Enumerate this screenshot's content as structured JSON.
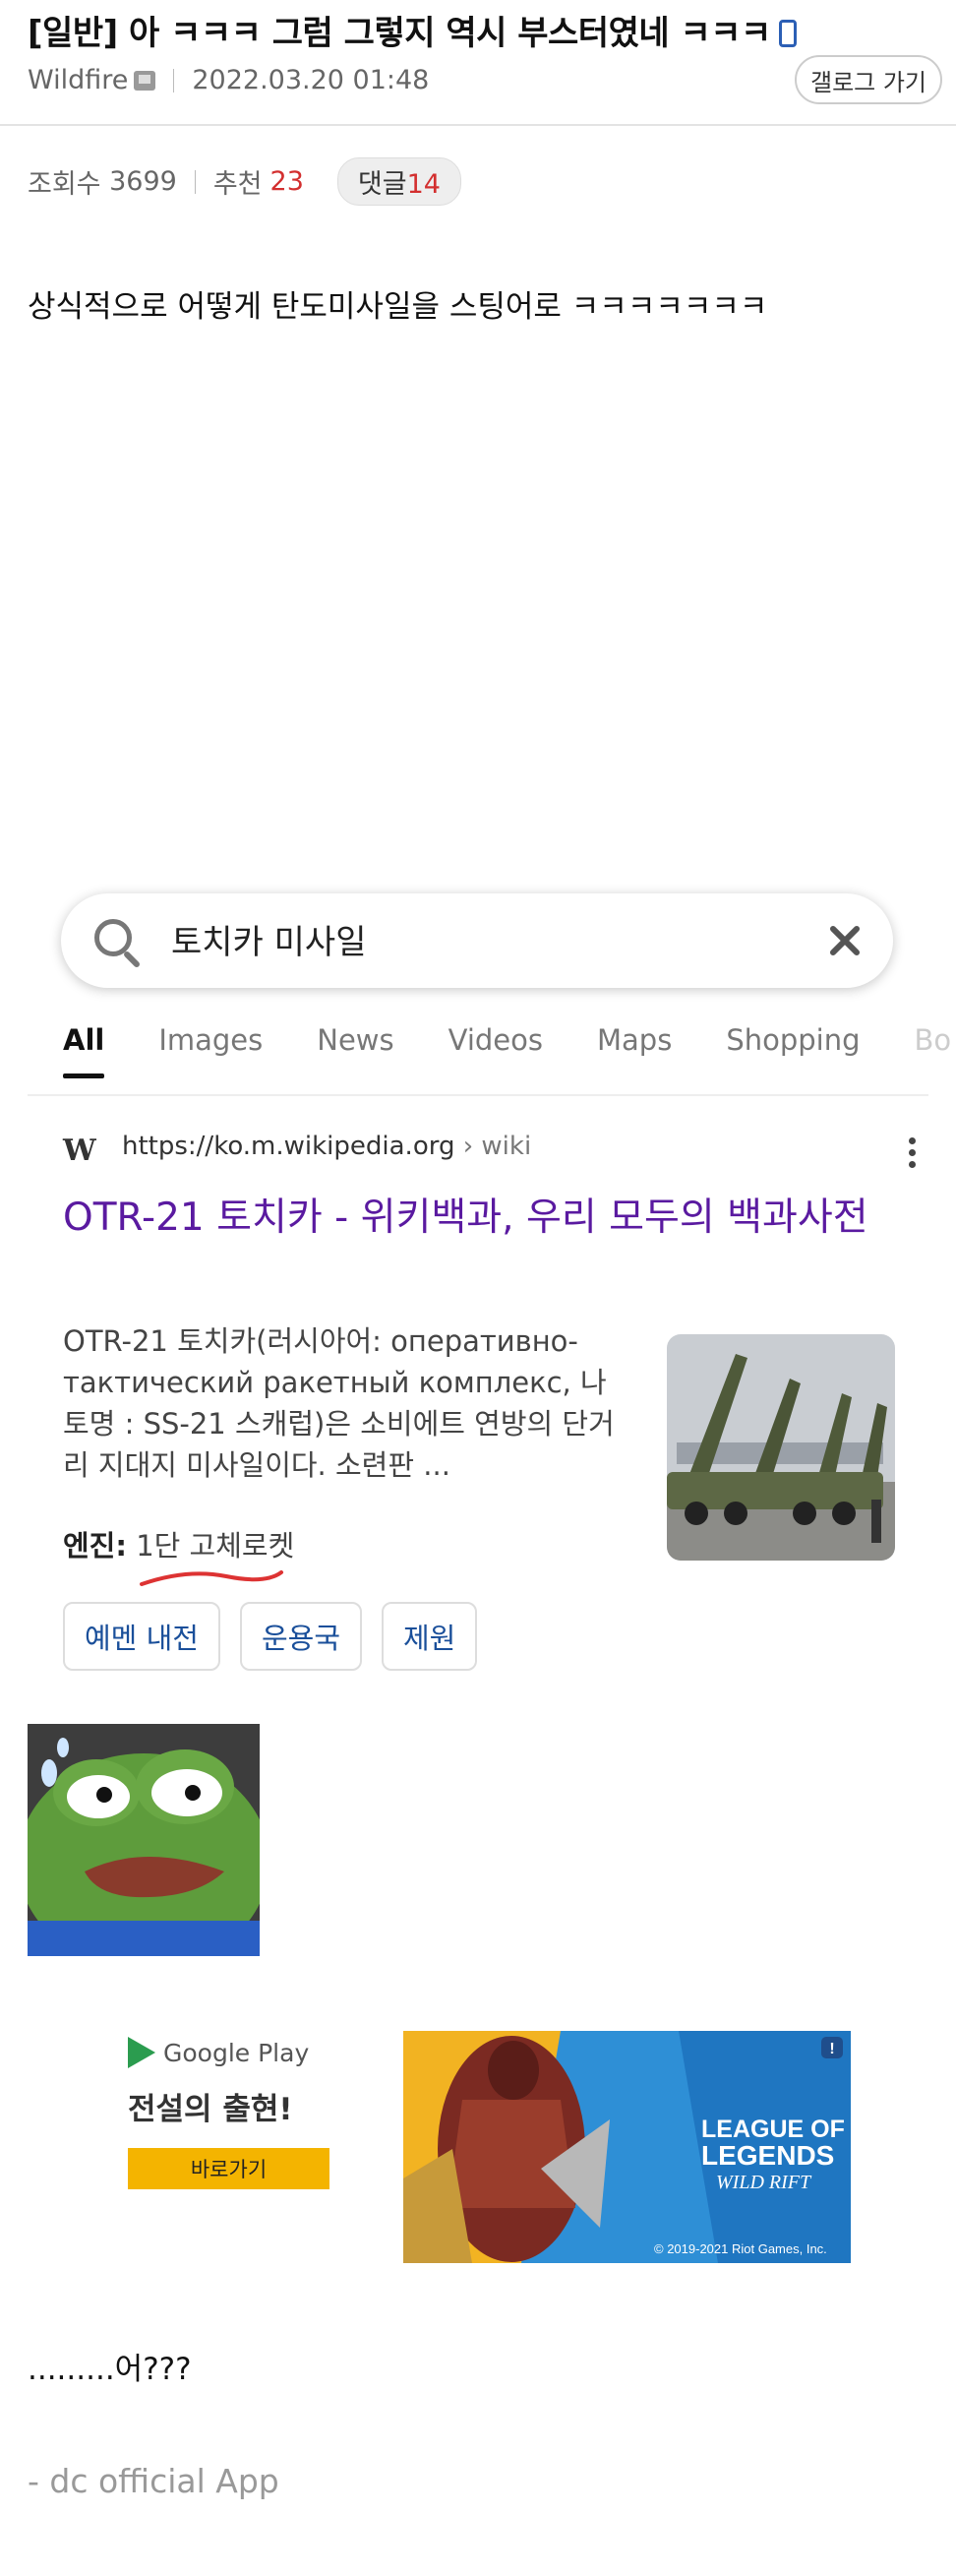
{
  "post": {
    "title": "[일반] 아 ㅋㅋㅋ 그럼 그렇지 역시 부스터였네 ㅋㅋㅋ",
    "author": "Wildfire",
    "date": "2022.03.20 01:48",
    "gallery_button": "갤로그 가기",
    "views_label": "조회수",
    "views": "3699",
    "recommend_label": "추천",
    "recommend": "23",
    "comments_label": "댓글",
    "comments": "14",
    "body_line_1": "상식적으로 어떻게 탄도미사일을 스팅어로 ㅋㅋㅋㅋㅋㅋㅋ",
    "body_line_2": ".........어???",
    "footer": "- dc official App"
  },
  "screenshot": {
    "search_query": "토치카 미사일",
    "tabs": [
      "All",
      "Images",
      "News",
      "Videos",
      "Maps",
      "Shopping",
      "Bo"
    ],
    "active_tab": "All",
    "result": {
      "url": "https://ko.m.wikipedia.org",
      "url_crumb": "› wiki",
      "title": "OTR-21 토치카 - 위키백과, 우리 모두의 백과사전",
      "snippet": "OTR-21 토치카(러시아어: оперативно-тактический ракетный комплекс, 나토명 : SS-21 스캐럽)은 소비에트 연방의 단거리 지대지 미사일이다. 소련판 ...",
      "engine_label": "엔진:",
      "engine_value": "1단 고체로켓",
      "chips": [
        "예멘 내전",
        "운용국",
        "제원"
      ]
    }
  },
  "ad": {
    "store": "Google Play",
    "headline": "전설의 출현!",
    "button": "바로가기",
    "brand_line_1": "LEAGUE OF",
    "brand_line_2": "LEGENDS",
    "brand_line_3": "WILD RIFT",
    "copyright": "© 2019-2021 Riot Games, Inc."
  },
  "colors": {
    "accent_red": "#d32f2f",
    "result_title": "#5a1aa0",
    "chip_text": "#1a4f9a",
    "ad_button": "#f4b400"
  }
}
